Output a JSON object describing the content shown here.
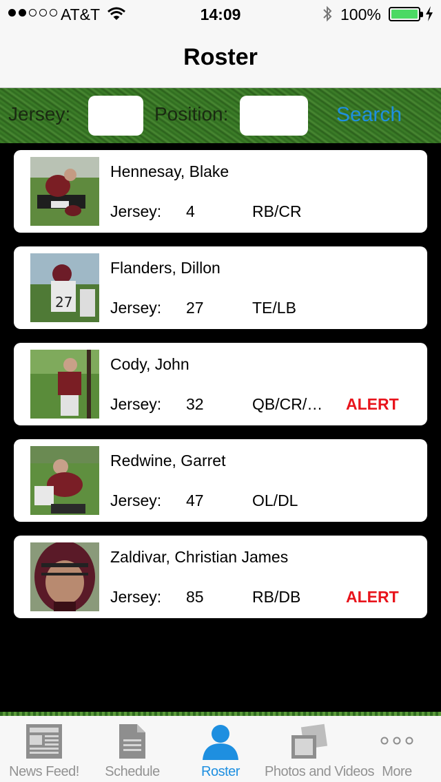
{
  "status": {
    "carrier": "AT&T",
    "time": "14:09",
    "battery": "100%"
  },
  "nav": {
    "title": "Roster"
  },
  "search": {
    "jersey_label": "Jersey:",
    "position_label": "Position:",
    "search_label": "Search",
    "jersey_value": "",
    "position_value": ""
  },
  "players": [
    {
      "name": "Hennesay, Blake",
      "jersey_label": "Jersey:",
      "jersey": "4",
      "position": "RB/CR",
      "alert": ""
    },
    {
      "name": "Flanders, Dillon",
      "jersey_label": "Jersey:",
      "jersey": "27",
      "position": "TE/LB",
      "alert": ""
    },
    {
      "name": "Cody, John",
      "jersey_label": "Jersey:",
      "jersey": "32",
      "position": "QB/CR/…",
      "alert": "ALERT"
    },
    {
      "name": "Redwine, Garret",
      "jersey_label": "Jersey:",
      "jersey": "47",
      "position": "OL/DL",
      "alert": ""
    },
    {
      "name": "Zaldivar, Christian James",
      "jersey_label": "Jersey:",
      "jersey": "85",
      "position": "RB/DB",
      "alert": "ALERT"
    }
  ],
  "tabs": [
    {
      "label": "News Feed!",
      "icon": "newspaper-icon"
    },
    {
      "label": "Schedule",
      "icon": "document-icon"
    },
    {
      "label": "Roster",
      "icon": "person-icon",
      "active": true
    },
    {
      "label": "Photos and Videos",
      "icon": "photos-icon"
    },
    {
      "label": "More",
      "icon": "more-icon"
    }
  ],
  "colors": {
    "accent": "#1e8fe0",
    "alert": "#e8141c",
    "battery": "#4cd964"
  }
}
